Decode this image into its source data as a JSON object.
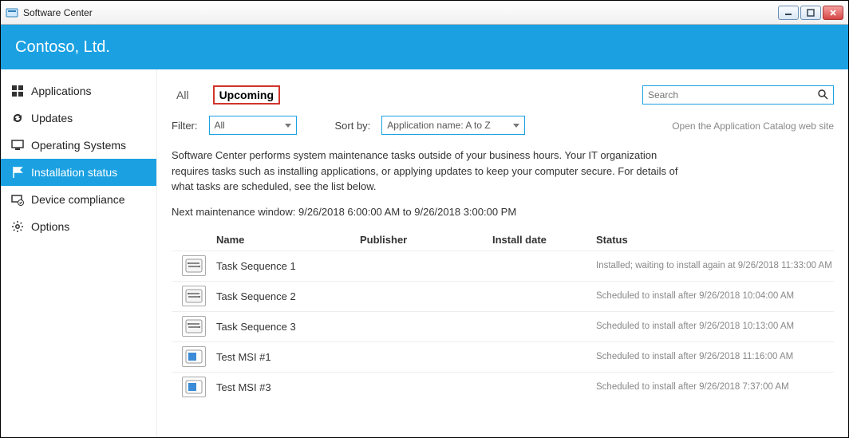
{
  "window": {
    "title": "Software Center"
  },
  "banner": {
    "org": "Contoso, Ltd."
  },
  "sidebar": {
    "items": [
      {
        "label": "Applications"
      },
      {
        "label": "Updates"
      },
      {
        "label": "Operating Systems"
      },
      {
        "label": "Installation status"
      },
      {
        "label": "Device compliance"
      },
      {
        "label": "Options"
      }
    ]
  },
  "tabs": {
    "all": "All",
    "upcoming": "Upcoming"
  },
  "filter": {
    "label": "Filter:",
    "value": "All"
  },
  "sort": {
    "label": "Sort by:",
    "value": "Application name: A to Z"
  },
  "search": {
    "placeholder": "Search"
  },
  "catalog_link": "Open the Application Catalog web site",
  "description": "Software Center performs system maintenance tasks outside of your business hours. Your IT organization requires tasks such as installing applications, or applying updates to keep your computer secure. For details of what tasks are scheduled, see the list below.",
  "maintenance": "Next maintenance window: 9/26/2018 6:00:00 AM to 9/26/2018 3:00:00 PM",
  "columns": {
    "name": "Name",
    "publisher": "Publisher",
    "install_date": "Install date",
    "status": "Status"
  },
  "rows": [
    {
      "type": "ts",
      "name": "Task Sequence 1",
      "publisher": "",
      "install_date": "",
      "status": "Installed; waiting to install again at 9/26/2018 11:33:00 AM"
    },
    {
      "type": "ts",
      "name": "Task Sequence 2",
      "publisher": "",
      "install_date": "",
      "status": "Scheduled to install after 9/26/2018 10:04:00 AM"
    },
    {
      "type": "ts",
      "name": "Task Sequence 3",
      "publisher": "",
      "install_date": "",
      "status": "Scheduled to install after 9/26/2018 10:13:00 AM"
    },
    {
      "type": "msi",
      "name": "Test MSI #1",
      "publisher": "",
      "install_date": "",
      "status": "Scheduled to install after 9/26/2018 11:16:00 AM"
    },
    {
      "type": "msi",
      "name": "Test MSI #3",
      "publisher": "",
      "install_date": "",
      "status": "Scheduled to install after 9/26/2018 7:37:00 AM"
    }
  ]
}
